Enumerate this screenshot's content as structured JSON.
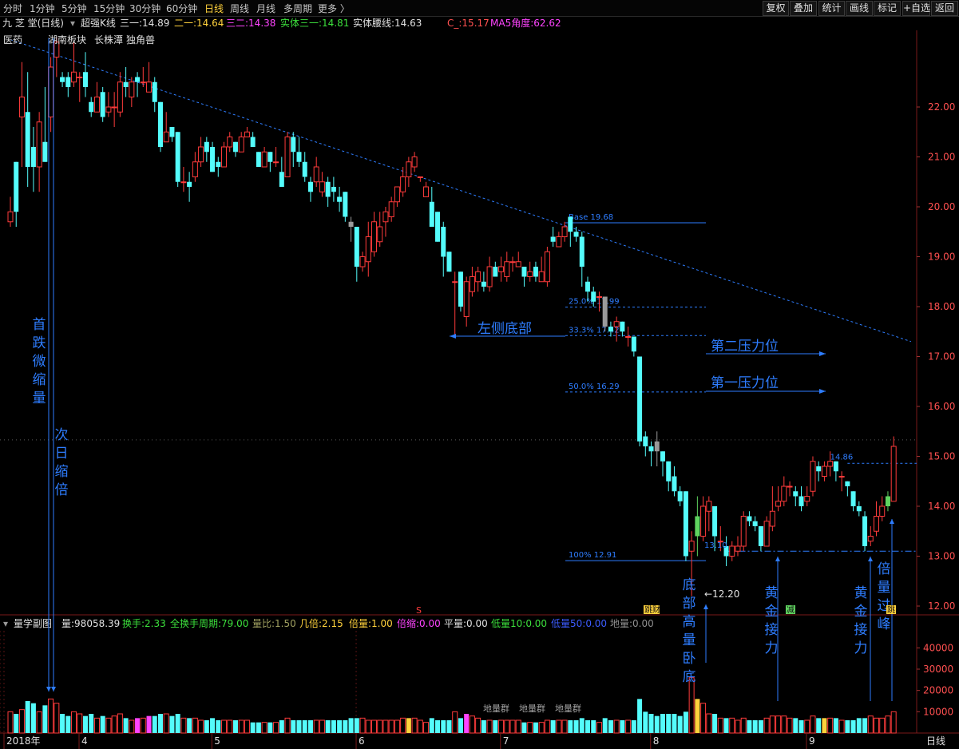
{
  "toolbar": {
    "timeframes": [
      {
        "label": "分时",
        "active": false
      },
      {
        "label": "1分钟",
        "active": false
      },
      {
        "label": "5分钟",
        "active": false
      },
      {
        "label": "15分钟",
        "active": false
      },
      {
        "label": "30分钟",
        "active": false
      },
      {
        "label": "60分钟",
        "active": false
      },
      {
        "label": "日线",
        "active": true
      },
      {
        "label": "周线",
        "active": false
      },
      {
        "label": "月线",
        "active": false
      },
      {
        "label": "多周期",
        "active": false
      },
      {
        "label": "更多 〉",
        "active": false
      }
    ],
    "right_buttons": [
      "复权",
      "叠加",
      "统计",
      "画线",
      "标记",
      "+自选",
      "返回"
    ]
  },
  "info": {
    "title": "九 芝 堂(日线)",
    "indicator": "超强K线",
    "items": [
      {
        "label": "三一:",
        "value": "14.89",
        "color": "#e0e0e0"
      },
      {
        "label": "二一:",
        "value": "14.64",
        "color": "#ffd23c"
      },
      {
        "label": "三二:",
        "value": "14.38",
        "color": "#ff44ff"
      },
      {
        "label": "实体三一:",
        "value": "14.81",
        "color": "#3ce03c"
      },
      {
        "label": "实体腰线:",
        "value": "14.63",
        "color": "#e0e0e0"
      },
      {
        "label": "C_:",
        "value": "15.17",
        "color": "#ff5050"
      },
      {
        "label": "MA5角度:",
        "value": "62.62",
        "color": "#ff44ff"
      }
    ]
  },
  "sector_tags": [
    "医药",
    "湖南板块",
    "长株潭",
    "独角兽"
  ],
  "colors": {
    "up": "#ff3b3b",
    "down": "#54fcfc",
    "annotation": "#2e7dff",
    "grid": "#7a1a1a",
    "background": "#000000"
  },
  "annotations": {
    "left_vertical_1": "首跌微缩量",
    "left_vertical_2": "次日缩倍",
    "left_bottom": "左侧底部",
    "pressure_2": "第二压力位",
    "pressure_1": "第一压力位",
    "bottom_vertical": "底部高量卧底",
    "golden_1": "黄金接力",
    "golden_2": "黄金接力",
    "peak": "倍量过峰",
    "low_mark": "←12.20",
    "small_low": "13.10",
    "last_level": "14.86",
    "fib_base": "Base 19.68",
    "fib_25": "25.0% 17.99",
    "fib_33": "33.3% 17.42",
    "fib_50": "50.0% 16.29",
    "fib_100": "100% 12.91",
    "tag_1": "跳财",
    "tag_2": "减",
    "tag_3": "跳",
    "red_tag": "S",
    "volume_groups": [
      "地量群",
      "地量群",
      "地量群"
    ]
  },
  "volume_bar": {
    "title": "量学副图",
    "items": [
      {
        "label": "量:",
        "value": "98058.39",
        "color": "#e0e0e0"
      },
      {
        "label": "换手:",
        "value": "2.33",
        "color": "#3ce03c"
      },
      {
        "label": "全换手周期:",
        "value": "79.00",
        "color": "#3ce03c"
      },
      {
        "label": "量比:",
        "value": "1.50",
        "color": "#a0a060"
      },
      {
        "label": "几倍:",
        "value": "2.15",
        "color": "#ffd23c"
      },
      {
        "label": "倍量:",
        "value": "1.00",
        "color": "#ffd23c"
      },
      {
        "label": "倍缩:",
        "value": "0.00",
        "color": "#ff44ff"
      },
      {
        "label": "平量:",
        "value": "0.00",
        "color": "#e0e0e0"
      },
      {
        "label": "低量10:",
        "value": "0.00",
        "color": "#3ce03c"
      },
      {
        "label": "低量50:",
        "value": "0.00",
        "color": "#3c5cff"
      },
      {
        "label": "地量:",
        "value": "0.00",
        "color": "#909090"
      }
    ]
  },
  "chart_data": {
    "type": "candlestick",
    "price_axis": {
      "ticks": [
        "22.00",
        "21.00",
        "20.00",
        "19.00",
        "18.00",
        "17.00",
        "16.00",
        "15.00",
        "14.00",
        "13.00",
        "12.00"
      ],
      "range": [
        11.75,
        23.3
      ]
    },
    "volume_axis": {
      "ticks": [
        "40000",
        "30000",
        "20000",
        "10000"
      ],
      "range": [
        0,
        48000
      ]
    },
    "x_axis": {
      "labels": [
        "2018年",
        "4",
        "5",
        "6",
        "7",
        "8",
        "9"
      ],
      "label_candle_index": [
        0,
        13,
        36,
        61,
        86,
        112,
        139
      ],
      "corner_label": "日线"
    },
    "trendline": {
      "start": [
        0,
        23.35
      ],
      "end": [
        156,
        17.3
      ]
    },
    "fib_levels": [
      {
        "label": "Base 19.68",
        "value": 19.68
      },
      {
        "label": "25.0% 17.99",
        "value": 17.99
      },
      {
        "label": "33.3% 17.42",
        "value": 17.42
      },
      {
        "label": "50.0% 16.29",
        "value": 16.29
      },
      {
        "label": "100% 12.91",
        "value": 12.91
      }
    ],
    "support_line": 13.1,
    "resistance_line": 14.86,
    "candles": [
      [
        19.7,
        19.9,
        20.2,
        19.6,
        10000
      ],
      [
        20.9,
        19.9,
        20.9,
        19.6,
        9000
      ],
      [
        21.8,
        22.2,
        22.9,
        20.8,
        11000
      ],
      [
        21.9,
        20.8,
        22.7,
        20.4,
        15000
      ],
      [
        21.2,
        20.8,
        21.6,
        20.3,
        14000
      ],
      [
        20.8,
        21.7,
        21.9,
        20.3,
        10000
      ],
      [
        21.3,
        20.9,
        22.4,
        20.9,
        13000
      ],
      [
        21.8,
        22.8,
        23.0,
        21.5,
        16000
      ],
      [
        23.0,
        23.3,
        23.4,
        22.6,
        14000
      ],
      [
        22.6,
        22.5,
        22.7,
        22.4,
        9000
      ],
      [
        22.6,
        22.4,
        22.7,
        22.2,
        8000
      ],
      [
        22.5,
        22.7,
        23.3,
        22.4,
        10000
      ],
      [
        22.6,
        22.6,
        22.7,
        22.1,
        9000
      ],
      [
        22.7,
        22.4,
        23.1,
        22.2,
        8000
      ],
      [
        22.1,
        21.9,
        22.2,
        21.8,
        9000
      ],
      [
        21.9,
        22.2,
        22.5,
        21.9,
        7000
      ],
      [
        22.3,
        21.8,
        22.4,
        21.7,
        8000
      ],
      [
        21.9,
        22.0,
        22.3,
        21.8,
        7000
      ],
      [
        22.0,
        22.0,
        22.3,
        21.6,
        8000
      ],
      [
        21.9,
        22.5,
        22.7,
        21.8,
        9000
      ],
      [
        22.5,
        22.4,
        22.8,
        22.2,
        7000
      ],
      [
        22.2,
        22.5,
        22.6,
        22.0,
        6000
      ],
      [
        22.6,
        22.5,
        22.7,
        22.2,
        7000
      ],
      [
        22.5,
        22.5,
        22.8,
        22.4,
        7000
      ],
      [
        22.3,
        22.5,
        22.9,
        22.3,
        8000
      ],
      [
        22.5,
        22.1,
        22.6,
        21.9,
        8000
      ],
      [
        22.1,
        21.2,
        22.1,
        21.1,
        9000
      ],
      [
        21.3,
        21.5,
        21.9,
        21.3,
        9000
      ],
      [
        21.6,
        21.4,
        21.6,
        21.3,
        8000
      ],
      [
        21.5,
        20.5,
        21.5,
        20.4,
        9000
      ],
      [
        20.5,
        20.5,
        20.8,
        20.3,
        7000
      ],
      [
        20.5,
        20.4,
        20.7,
        20.1,
        7000
      ],
      [
        20.6,
        20.9,
        21.1,
        20.5,
        7000
      ],
      [
        20.9,
        21.2,
        21.4,
        20.8,
        6000
      ],
      [
        21.3,
        21.1,
        21.4,
        20.9,
        6000
      ],
      [
        21.2,
        20.7,
        21.3,
        20.7,
        7000
      ],
      [
        20.9,
        20.8,
        21.0,
        20.6,
        6000
      ],
      [
        20.8,
        21.2,
        21.3,
        20.8,
        6000
      ],
      [
        21.2,
        21.4,
        21.5,
        21.1,
        6000
      ],
      [
        21.3,
        21.1,
        21.3,
        21.0,
        6000
      ],
      [
        21.1,
        21.4,
        21.5,
        21.1,
        6000
      ],
      [
        21.4,
        21.5,
        21.6,
        21.4,
        6000
      ],
      [
        21.4,
        21.2,
        21.5,
        21.2,
        5000
      ],
      [
        21.1,
        20.8,
        21.1,
        20.8,
        5000
      ],
      [
        20.8,
        21.1,
        21.2,
        20.8,
        5000
      ],
      [
        21.1,
        20.9,
        21.1,
        20.7,
        5000
      ],
      [
        20.9,
        20.9,
        21.2,
        20.8,
        5000
      ],
      [
        20.7,
        20.4,
        21.0,
        20.4,
        6000
      ],
      [
        20.6,
        21.4,
        21.5,
        20.6,
        7000
      ],
      [
        21.4,
        21.1,
        21.5,
        20.8,
        6000
      ],
      [
        21.1,
        20.9,
        21.4,
        20.8,
        6000
      ],
      [
        20.9,
        20.6,
        21.1,
        20.5,
        6000
      ],
      [
        20.5,
        20.3,
        20.6,
        20.1,
        6000
      ],
      [
        20.5,
        20.8,
        21.0,
        20.4,
        6000
      ],
      [
        20.3,
        20.5,
        20.7,
        20.2,
        6000
      ],
      [
        20.5,
        20.2,
        20.6,
        20.0,
        6000
      ],
      [
        20.4,
        20.3,
        20.6,
        20.1,
        6000
      ],
      [
        20.2,
        20.1,
        20.4,
        19.9,
        6000
      ],
      [
        20.3,
        19.8,
        20.3,
        19.7,
        6000
      ],
      [
        19.7,
        19.6,
        19.8,
        19.3,
        7000
      ],
      [
        19.6,
        18.8,
        19.6,
        18.5,
        7000
      ],
      [
        18.8,
        19.0,
        19.1,
        18.7,
        7000
      ],
      [
        18.9,
        19.4,
        19.7,
        18.6,
        6000
      ],
      [
        19.1,
        19.7,
        19.9,
        19.0,
        6000
      ],
      [
        19.3,
        19.6,
        19.9,
        19.2,
        6000
      ],
      [
        19.7,
        19.9,
        20.0,
        19.4,
        6000
      ],
      [
        19.8,
        20.1,
        20.2,
        19.7,
        6000
      ],
      [
        20.1,
        20.4,
        20.4,
        20.0,
        6000
      ],
      [
        20.3,
        20.6,
        20.8,
        20.2,
        7000
      ],
      [
        20.6,
        20.9,
        21.0,
        20.4,
        7000
      ],
      [
        20.8,
        21.0,
        21.1,
        20.7,
        7000
      ],
      [
        20.6,
        20.6,
        20.5,
        20.6,
        6000
      ],
      [
        20.2,
        20.4,
        20.5,
        20.2,
        5000
      ],
      [
        20.1,
        19.6,
        20.4,
        19.6,
        7000
      ],
      [
        19.9,
        19.3,
        19.9,
        19.3,
        6000
      ],
      [
        19.6,
        19.0,
        19.7,
        18.6,
        6000
      ],
      [
        19.1,
        18.7,
        19.1,
        18.7,
        6000
      ],
      [
        18.5,
        18.5,
        18.7,
        17.4,
        10000
      ],
      [
        18.7,
        18.0,
        18.7,
        17.9,
        7000
      ],
      [
        17.8,
        18.5,
        18.6,
        17.6,
        9000
      ],
      [
        18.3,
        18.6,
        18.8,
        18.2,
        8000
      ],
      [
        18.5,
        18.7,
        18.8,
        18.3,
        7000
      ],
      [
        18.5,
        18.4,
        18.7,
        18.3,
        6000
      ],
      [
        18.4,
        18.8,
        19.0,
        18.3,
        6000
      ],
      [
        18.8,
        18.6,
        18.9,
        18.6,
        6000
      ],
      [
        18.7,
        18.8,
        19.0,
        18.5,
        6000
      ],
      [
        18.6,
        18.9,
        19.1,
        18.5,
        6000
      ],
      [
        18.9,
        18.9,
        19.0,
        18.7,
        6000
      ],
      [
        18.8,
        18.9,
        19.1,
        18.8,
        6000
      ],
      [
        18.8,
        18.6,
        18.8,
        18.4,
        5000
      ],
      [
        18.6,
        18.7,
        18.9,
        18.5,
        5000
      ],
      [
        18.8,
        18.6,
        18.9,
        18.5,
        5000
      ],
      [
        18.5,
        18.7,
        19.0,
        18.5,
        5000
      ],
      [
        18.5,
        19.1,
        19.2,
        18.4,
        6000
      ],
      [
        19.4,
        19.3,
        19.6,
        19.2,
        6000
      ],
      [
        19.2,
        19.4,
        19.5,
        19.2,
        6000
      ],
      [
        19.4,
        19.6,
        19.7,
        19.3,
        6000
      ],
      [
        19.8,
        19.5,
        19.8,
        19.2,
        6000
      ],
      [
        19.5,
        19.4,
        19.6,
        19.3,
        6000
      ],
      [
        19.4,
        18.8,
        19.5,
        18.4,
        7000
      ],
      [
        18.5,
        18.3,
        18.6,
        18.1,
        6000
      ],
      [
        18.3,
        18.1,
        18.4,
        18.0,
        6000
      ],
      [
        18.2,
        18.2,
        18.3,
        17.9,
        5000
      ],
      [
        18.2,
        17.6,
        18.2,
        17.5,
        7000
      ],
      [
        17.6,
        17.5,
        17.7,
        17.4,
        6000
      ],
      [
        17.6,
        17.7,
        17.8,
        17.3,
        6000
      ],
      [
        17.7,
        17.5,
        17.7,
        17.4,
        6000
      ],
      [
        17.4,
        17.4,
        17.6,
        17.2,
        6000
      ],
      [
        17.4,
        17.1,
        17.4,
        17.0,
        6000
      ],
      [
        17.0,
        15.3,
        17.0,
        15.2,
        16000
      ],
      [
        15.4,
        15.2,
        15.5,
        15.0,
        10000
      ],
      [
        15.2,
        15.1,
        15.3,
        14.8,
        9000
      ],
      [
        15.3,
        15.1,
        15.5,
        14.8,
        8000
      ],
      [
        15.1,
        14.9,
        15.1,
        14.6,
        9000
      ],
      [
        14.9,
        14.5,
        14.9,
        14.3,
        9000
      ],
      [
        14.6,
        14.3,
        14.8,
        14.2,
        9000
      ],
      [
        14.3,
        14.1,
        14.4,
        14.0,
        8000
      ],
      [
        14.3,
        13.0,
        14.3,
        12.9,
        10000
      ],
      [
        13.1,
        13.3,
        13.5,
        12.2,
        26000
      ],
      [
        13.4,
        13.8,
        14.2,
        13.0,
        16000
      ],
      [
        13.4,
        14.0,
        14.2,
        13.3,
        14000
      ],
      [
        13.9,
        14.1,
        14.2,
        13.5,
        9000
      ],
      [
        14.0,
        13.4,
        14.0,
        13.1,
        9000
      ],
      [
        13.3,
        13.3,
        13.6,
        13.1,
        7000
      ],
      [
        13.2,
        13.0,
        13.4,
        12.8,
        7000
      ],
      [
        13.0,
        13.2,
        13.3,
        12.9,
        7000
      ],
      [
        13.1,
        13.2,
        13.4,
        13.0,
        6000
      ],
      [
        13.2,
        13.8,
        13.9,
        13.1,
        7000
      ],
      [
        13.8,
        13.7,
        13.9,
        13.6,
        6000
      ],
      [
        13.7,
        13.6,
        13.8,
        13.5,
        6000
      ],
      [
        13.6,
        13.2,
        13.6,
        13.1,
        6000
      ],
      [
        13.2,
        13.7,
        13.8,
        13.2,
        7000
      ],
      [
        13.6,
        13.9,
        14.4,
        13.5,
        8000
      ],
      [
        14.0,
        14.1,
        14.4,
        13.9,
        8000
      ],
      [
        14.1,
        14.4,
        14.6,
        14.0,
        8000
      ],
      [
        14.4,
        14.4,
        14.5,
        14.2,
        7000
      ],
      [
        14.3,
        14.2,
        14.4,
        14.0,
        7000
      ],
      [
        14.2,
        14.0,
        14.4,
        13.9,
        6000
      ],
      [
        14.1,
        14.2,
        14.4,
        14.0,
        6000
      ],
      [
        14.3,
        14.9,
        15.0,
        14.2,
        8000
      ],
      [
        14.8,
        14.7,
        14.9,
        14.5,
        7000
      ],
      [
        14.6,
        14.8,
        14.9,
        14.5,
        7000
      ],
      [
        14.8,
        14.9,
        15.1,
        14.6,
        7000
      ],
      [
        14.9,
        14.7,
        14.9,
        14.5,
        7000
      ],
      [
        14.6,
        14.6,
        14.7,
        14.3,
        6000
      ],
      [
        14.5,
        14.4,
        14.5,
        14.2,
        6000
      ],
      [
        14.3,
        14.0,
        14.3,
        13.9,
        6000
      ],
      [
        14.0,
        13.9,
        14.1,
        13.8,
        7000
      ],
      [
        13.8,
        13.2,
        13.9,
        13.1,
        7000
      ],
      [
        13.3,
        13.4,
        13.6,
        13.2,
        8000
      ],
      [
        13.5,
        13.8,
        14.1,
        13.4,
        7000
      ],
      [
        13.8,
        14.0,
        14.2,
        13.7,
        7000
      ],
      [
        14.0,
        14.2,
        14.3,
        13.9,
        8000
      ],
      [
        14.1,
        15.2,
        15.4,
        14.1,
        10000
      ]
    ]
  }
}
